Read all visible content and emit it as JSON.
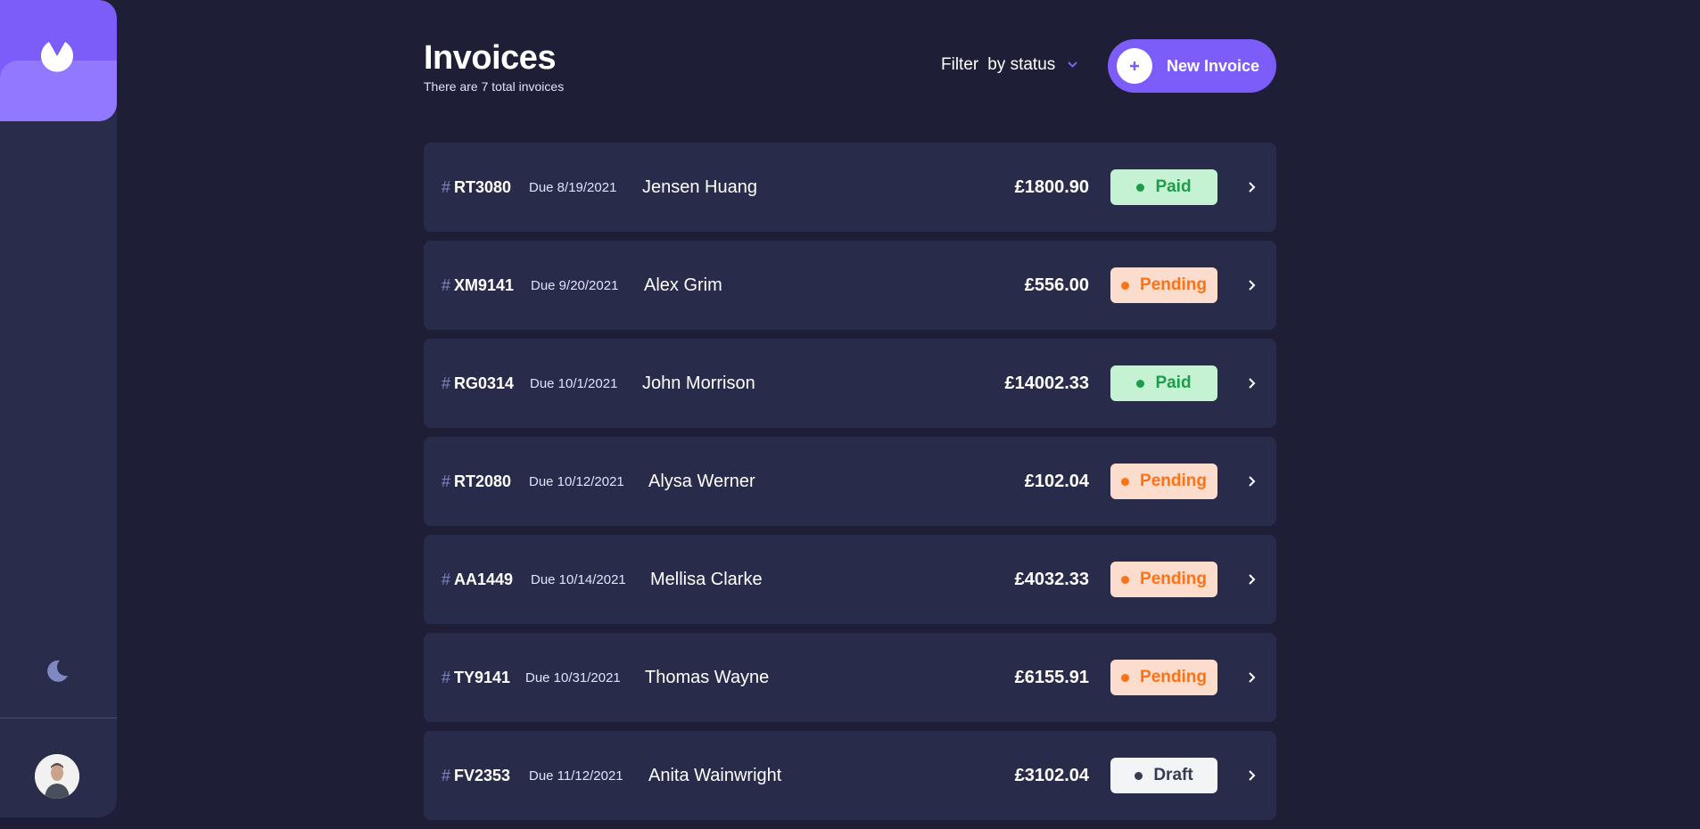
{
  "header": {
    "title": "Invoices",
    "subtitle": "There are 7 total invoices",
    "filter_label": "Filter",
    "filter_value": "by status",
    "new_invoice_label": "New Invoice"
  },
  "colors": {
    "accent": "#7c5df9",
    "background": "#1e1f36",
    "card": "#292b4a",
    "paid": "#1d9c4a",
    "pending": "#ff7214",
    "draft": "#373b53"
  },
  "icons": {
    "logo": "logo-icon",
    "theme": "moon-icon",
    "plus": "plus-icon",
    "filter": "chevron-down-icon",
    "row": "chevron-right-icon"
  },
  "invoices": [
    {
      "hash": "#",
      "id": "RT3080",
      "due": "Due 8/19/2021",
      "client": "Jensen Huang",
      "amount": "£1800.90",
      "status": "Paid"
    },
    {
      "hash": "#",
      "id": "XM9141",
      "due": "Due 9/20/2021",
      "client": "Alex Grim",
      "amount": "£556.00",
      "status": "Pending"
    },
    {
      "hash": "#",
      "id": "RG0314",
      "due": "Due 10/1/2021",
      "client": "John Morrison",
      "amount": "£14002.33",
      "status": "Paid"
    },
    {
      "hash": "#",
      "id": "RT2080",
      "due": "Due 10/12/2021",
      "client": "Alysa Werner",
      "amount": "£102.04",
      "status": "Pending"
    },
    {
      "hash": "#",
      "id": "AA1449",
      "due": "Due 10/14/2021",
      "client": "Mellisa Clarke",
      "amount": "£4032.33",
      "status": "Pending"
    },
    {
      "hash": "#",
      "id": "TY9141",
      "due": "Due 10/31/2021",
      "client": "Thomas Wayne",
      "amount": "£6155.91",
      "status": "Pending"
    },
    {
      "hash": "#",
      "id": "FV2353",
      "due": "Due 11/12/2021",
      "client": "Anita Wainwright",
      "amount": "£3102.04",
      "status": "Draft"
    }
  ]
}
